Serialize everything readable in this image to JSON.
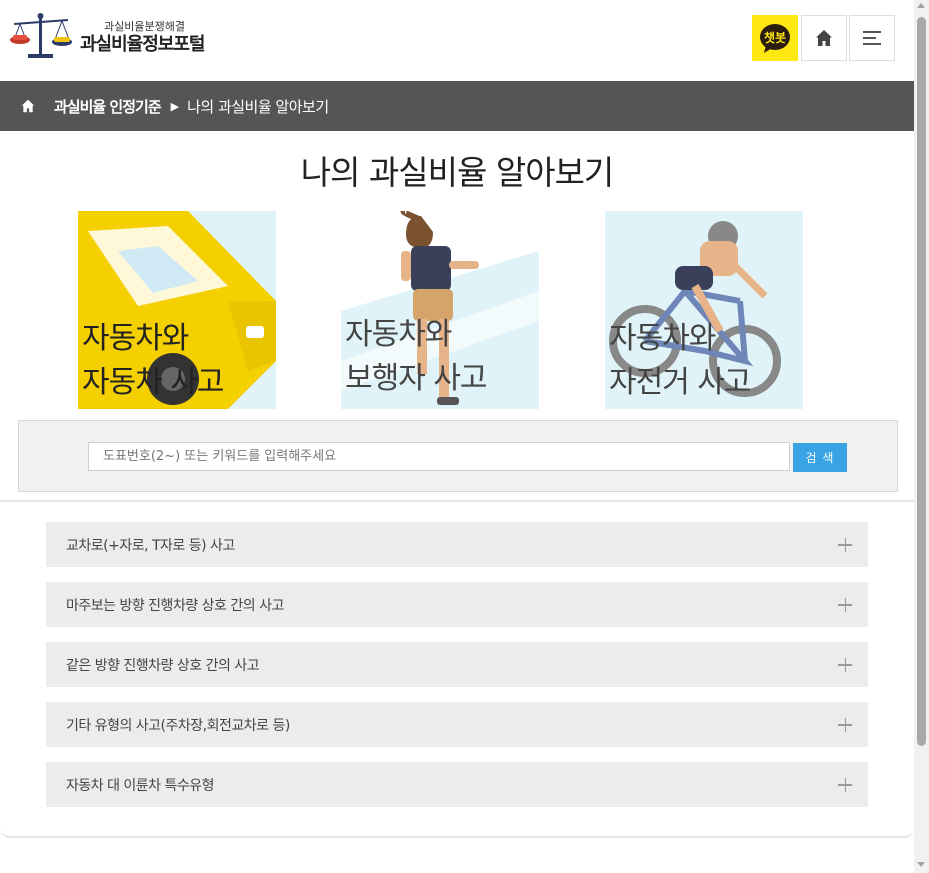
{
  "header": {
    "logo_sub": "과실비율분쟁해결",
    "logo_main": "과실비율정보포털",
    "chatbot_label": "챗봇"
  },
  "breadcrumb": {
    "item1": "과실비율 인정기준",
    "arrow": "▶",
    "item2": "나의 과실비율 알아보기"
  },
  "page_title": "나의 과실비율 알아보기",
  "cards": [
    {
      "line1": "자동차와",
      "line2": "자동차 사고"
    },
    {
      "line1": "자동차와",
      "line2": "보행자 사고"
    },
    {
      "line1": "자동차와",
      "line2": "자전거 사고"
    }
  ],
  "search": {
    "placeholder": "도표번호(2~) 또는 키워드를 입력해주세요",
    "button_label": "검 색"
  },
  "accordion": [
    {
      "label": "교차로(+자로, T자로 등) 사고"
    },
    {
      "label": "마주보는 방향 진행차량 상호 간의 사고"
    },
    {
      "label": "같은 방향 진행차량 상호 간의 사고"
    },
    {
      "label": "기타 유형의 사고(주차장,회전교차로 등)"
    },
    {
      "label": "자동차 대 이륜차 특수유형"
    }
  ],
  "colors": {
    "breadcrumb_bg": "#555555",
    "search_button": "#3aa3e3",
    "chatbot_bg": "#ffe812",
    "accordion_bg": "#ececec"
  }
}
